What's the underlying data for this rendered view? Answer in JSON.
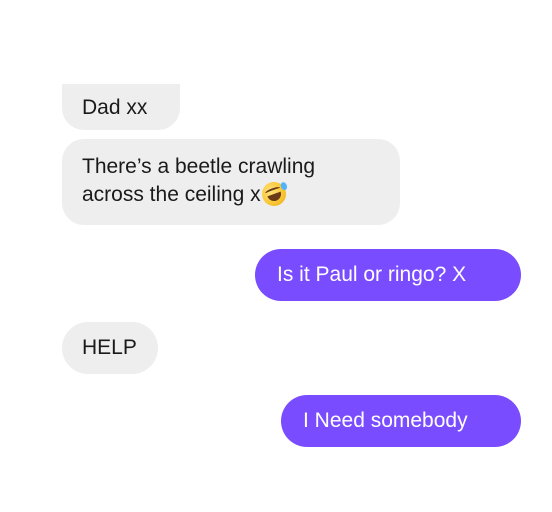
{
  "conversation": {
    "messages": [
      {
        "direction": "incoming",
        "text": "Dad xx"
      },
      {
        "direction": "incoming",
        "lines": [
          "There’s a beetle crawling",
          "across the ceiling x"
        ],
        "emoji": "rolling-on-floor-laughing-emoji"
      },
      {
        "direction": "outgoing",
        "text": "Is it Paul or ringo? X"
      },
      {
        "direction": "incoming",
        "text": "HELP"
      },
      {
        "direction": "outgoing",
        "text": "I Need somebody"
      }
    ]
  },
  "colors": {
    "incoming_bubble": "#eeeeee",
    "outgoing_bubble": "#7a4cff",
    "background": "#ffffff"
  }
}
